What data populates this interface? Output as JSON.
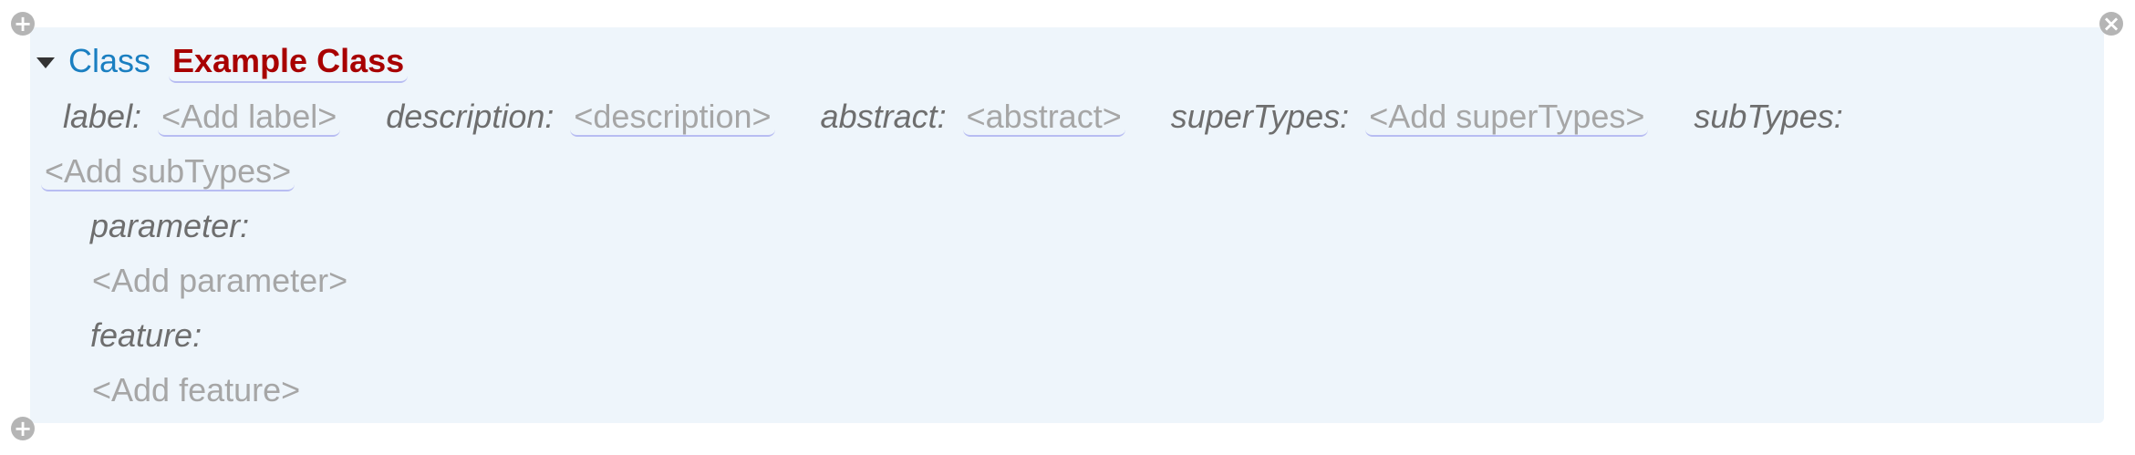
{
  "controls": {
    "add_top_icon": "plus-circle-icon",
    "add_bottom_icon": "plus-circle-icon",
    "close_icon": "close-circle-icon",
    "collapse_icon": "triangle-down-icon"
  },
  "class": {
    "keyword": "Class",
    "name": "Example Class"
  },
  "properties": {
    "label": {
      "label": "label:",
      "value": "<Add label>"
    },
    "description": {
      "label": "description:",
      "value": "<description>"
    },
    "abstract": {
      "label": "abstract:",
      "value": "<abstract>"
    },
    "superTypes": {
      "label": "superTypes:",
      "value": "<Add superTypes>"
    },
    "subTypes": {
      "label": "subTypes:",
      "value": "<Add subTypes>"
    }
  },
  "children": {
    "parameter": {
      "label": "parameter:",
      "add": "<Add parameter>"
    },
    "feature": {
      "label": "feature:",
      "add": "<Add feature>"
    }
  },
  "colors": {
    "keyword": "#1a7fc1",
    "class_name": "#a80000",
    "panel_bg": "#eef5fb",
    "underline": "#b8bdf2"
  }
}
